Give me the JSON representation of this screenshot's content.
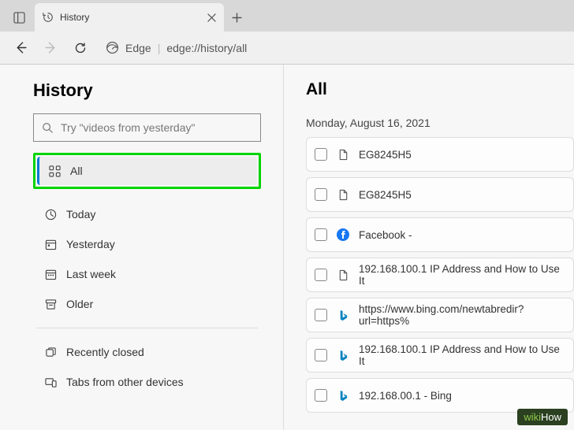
{
  "tab": {
    "title": "History"
  },
  "addressbar": {
    "site": "Edge",
    "url": "edge://history/all"
  },
  "sidebar": {
    "title": "History",
    "search_placeholder": "Try \"videos from yesterday\"",
    "items": {
      "all": "All",
      "today": "Today",
      "yesterday": "Yesterday",
      "lastweek": "Last week",
      "older": "Older",
      "recently_closed": "Recently closed",
      "other_devices": "Tabs from other devices"
    }
  },
  "main": {
    "heading": "All",
    "date_header": "Monday, August 16, 2021",
    "entries": [
      {
        "icon": "file",
        "title": "EG8245H5"
      },
      {
        "icon": "file",
        "title": "EG8245H5"
      },
      {
        "icon": "fb",
        "title": "Facebook -"
      },
      {
        "icon": "file",
        "title": "192.168.100.1 IP Address and How to Use It"
      },
      {
        "icon": "bing",
        "title": "https://www.bing.com/newtabredir?url=https%"
      },
      {
        "icon": "bing",
        "title": "192.168.100.1 IP Address and How to Use It"
      },
      {
        "icon": "bing",
        "title": "192.168.00.1 - Bing"
      }
    ]
  },
  "watermark": {
    "prefix": "wiki",
    "suffix": "How"
  }
}
